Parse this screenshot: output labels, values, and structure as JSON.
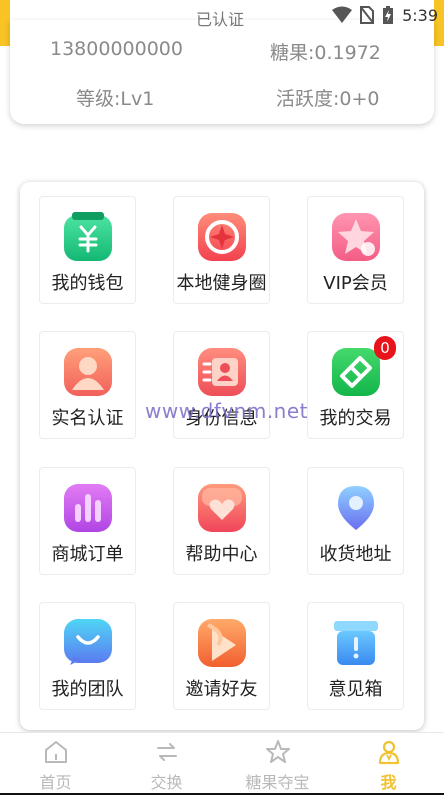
{
  "status_bar": {
    "center_text": "已认证",
    "time": "5:39"
  },
  "profile": {
    "phone": "13800000000",
    "candy": "糖果:0.1972",
    "level": "等级:Lv1",
    "activity": "活跃度:0+0"
  },
  "grid": {
    "items": [
      {
        "label": "我的钱包",
        "icon": "wallet-icon"
      },
      {
        "label": "本地健身圈",
        "icon": "fitness-circle-icon"
      },
      {
        "label": "VIP会员",
        "icon": "vip-star-icon"
      },
      {
        "label": "实名认证",
        "icon": "user-verify-icon"
      },
      {
        "label": "身份信息",
        "icon": "id-card-icon"
      },
      {
        "label": "我的交易",
        "icon": "trade-icon",
        "badge": "0"
      },
      {
        "label": "商城订单",
        "icon": "orders-chart-icon"
      },
      {
        "label": "帮助中心",
        "icon": "help-heart-icon"
      },
      {
        "label": "收货地址",
        "icon": "location-pin-icon"
      },
      {
        "label": "我的团队",
        "icon": "team-chat-icon"
      },
      {
        "label": "邀请好友",
        "icon": "invite-play-icon"
      },
      {
        "label": "意见箱",
        "icon": "suggestion-box-icon"
      }
    ]
  },
  "watermark": "www.dfvnm.net",
  "bottom_nav": {
    "items": [
      {
        "label": "首页",
        "icon": "home-icon"
      },
      {
        "label": "交换",
        "icon": "exchange-icon"
      },
      {
        "label": "糖果夺宝",
        "icon": "star-icon"
      },
      {
        "label": "我",
        "icon": "user-icon",
        "active": true
      }
    ]
  },
  "colors": {
    "accent": "#f7c325",
    "active_nav": "#f1c232",
    "badge": "#e8141b"
  }
}
